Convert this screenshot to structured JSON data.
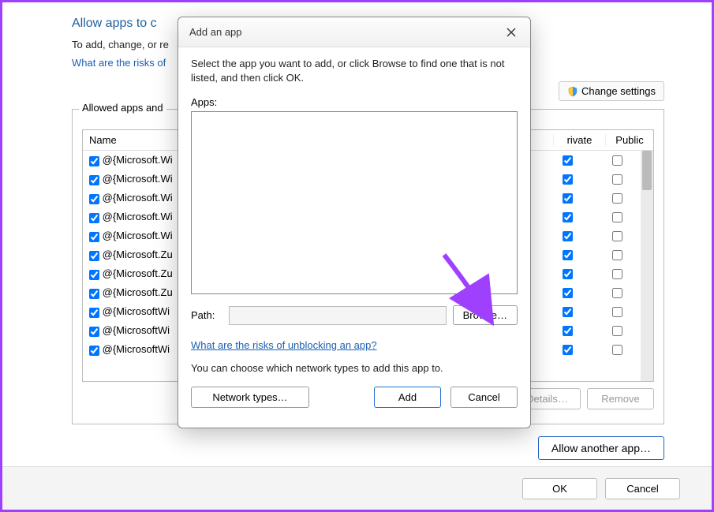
{
  "bg": {
    "title": "Allow apps to c",
    "subtitle": "To add, change, or re",
    "risks_link": "What are the risks of",
    "change_settings": "Change settings",
    "group_label": "Allowed apps and",
    "columns": {
      "name": "Name",
      "private": "Private",
      "public": "Public"
    },
    "private_short": "rivate",
    "rows": [
      {
        "name": "@{Microsoft.Wi",
        "priv": true,
        "pub": false
      },
      {
        "name": "@{Microsoft.Wi",
        "priv": true,
        "pub": false
      },
      {
        "name": "@{Microsoft.Wi",
        "priv": true,
        "pub": false
      },
      {
        "name": "@{Microsoft.Wi",
        "priv": true,
        "pub": false
      },
      {
        "name": "@{Microsoft.Wi",
        "priv": true,
        "pub": false
      },
      {
        "name": "@{Microsoft.Zu",
        "priv": true,
        "pub": false
      },
      {
        "name": "@{Microsoft.Zu",
        "priv": true,
        "pub": false
      },
      {
        "name": "@{Microsoft.Zu",
        "priv": true,
        "pub": false
      },
      {
        "name": "@{MicrosoftWi",
        "priv": true,
        "pub": false
      },
      {
        "name": "@{MicrosoftWi",
        "priv": true,
        "pub": false
      },
      {
        "name": "@{MicrosoftWi",
        "priv": true,
        "pub": false
      }
    ],
    "details_btn": "Details…",
    "remove_btn": "Remove",
    "allow_another": "Allow another app…",
    "ok": "OK",
    "cancel": "Cancel"
  },
  "modal": {
    "title": "Add an app",
    "instruction": "Select the app you want to add, or click Browse to find one that is not listed, and then click OK.",
    "apps_label": "Apps:",
    "path_label": "Path:",
    "path_value": "",
    "browse": "Browse…",
    "risks_link": "What are the risks of unblocking an app?",
    "desc": "You can choose which network types to add this app to.",
    "network_types": "Network types…",
    "add": "Add",
    "cancel": "Cancel"
  }
}
